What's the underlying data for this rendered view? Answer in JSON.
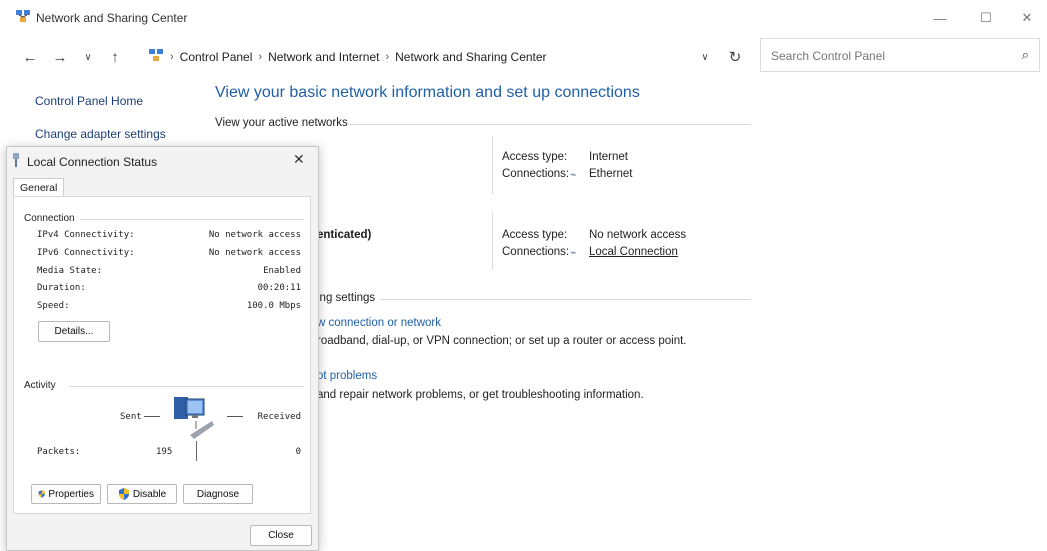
{
  "window": {
    "title": "Network and Sharing Center"
  },
  "nav": {
    "breadcrumbs": [
      "Control Panel",
      "Network and Internet",
      "Network and Sharing Center"
    ],
    "search_placeholder": "Search Control Panel"
  },
  "sidebar": {
    "items": [
      {
        "label": "Control Panel Home"
      },
      {
        "label": "Change adapter settings"
      }
    ]
  },
  "main": {
    "heading": "View your basic network information and set up connections",
    "active_networks_label": "View your active networks",
    "networks": [
      {
        "name_fragment": "",
        "access_type_label": "Access type:",
        "access_type": "Internet",
        "connections_label": "Connections:",
        "connection": "Ethernet"
      },
      {
        "name_fragment": "enticated)",
        "access_type_label": "Access type:",
        "access_type": "No network access",
        "connections_label": "Connections:",
        "connection": "Local Connection"
      }
    ],
    "change_settings_label": "ing settings",
    "tasks": [
      {
        "link": "w connection or network",
        "desc": "roadband, dial-up, or VPN connection; or set up a router or access point."
      },
      {
        "link": "ot problems",
        "desc": "and repair network problems, or get troubleshooting information."
      }
    ]
  },
  "dialog": {
    "title": "Local Connection Status",
    "tab": "General",
    "connection_group": "Connection",
    "rows": [
      {
        "label": "IPv4 Connectivity:",
        "value": "No network access"
      },
      {
        "label": "IPv6 Connectivity:",
        "value": "No network access"
      },
      {
        "label": "Media State:",
        "value": "Enabled"
      },
      {
        "label": "Duration:",
        "value": "00:20:11"
      },
      {
        "label": "Speed:",
        "value": "100.0 Mbps"
      }
    ],
    "details_button": "Details...",
    "activity_group": "Activity",
    "sent_label": "Sent",
    "received_label": "Received",
    "packets_label": "Packets:",
    "packets_sent": "195",
    "packets_received": "0",
    "properties_button": "Properties",
    "disable_button": "Disable",
    "diagnose_button": "Diagnose",
    "close_button": "Close"
  },
  "colors": {
    "link": "#1f5fa8",
    "dialog_bg": "#f3f3f3"
  },
  "icons": [
    "network-center-icon",
    "back-icon",
    "forward-icon",
    "recent-icon",
    "up-icon",
    "refresh-icon",
    "search-icon",
    "minimize-icon",
    "maximize-icon",
    "close-icon",
    "ethernet-icon",
    "shield-icon",
    "computer-network-icon"
  ]
}
